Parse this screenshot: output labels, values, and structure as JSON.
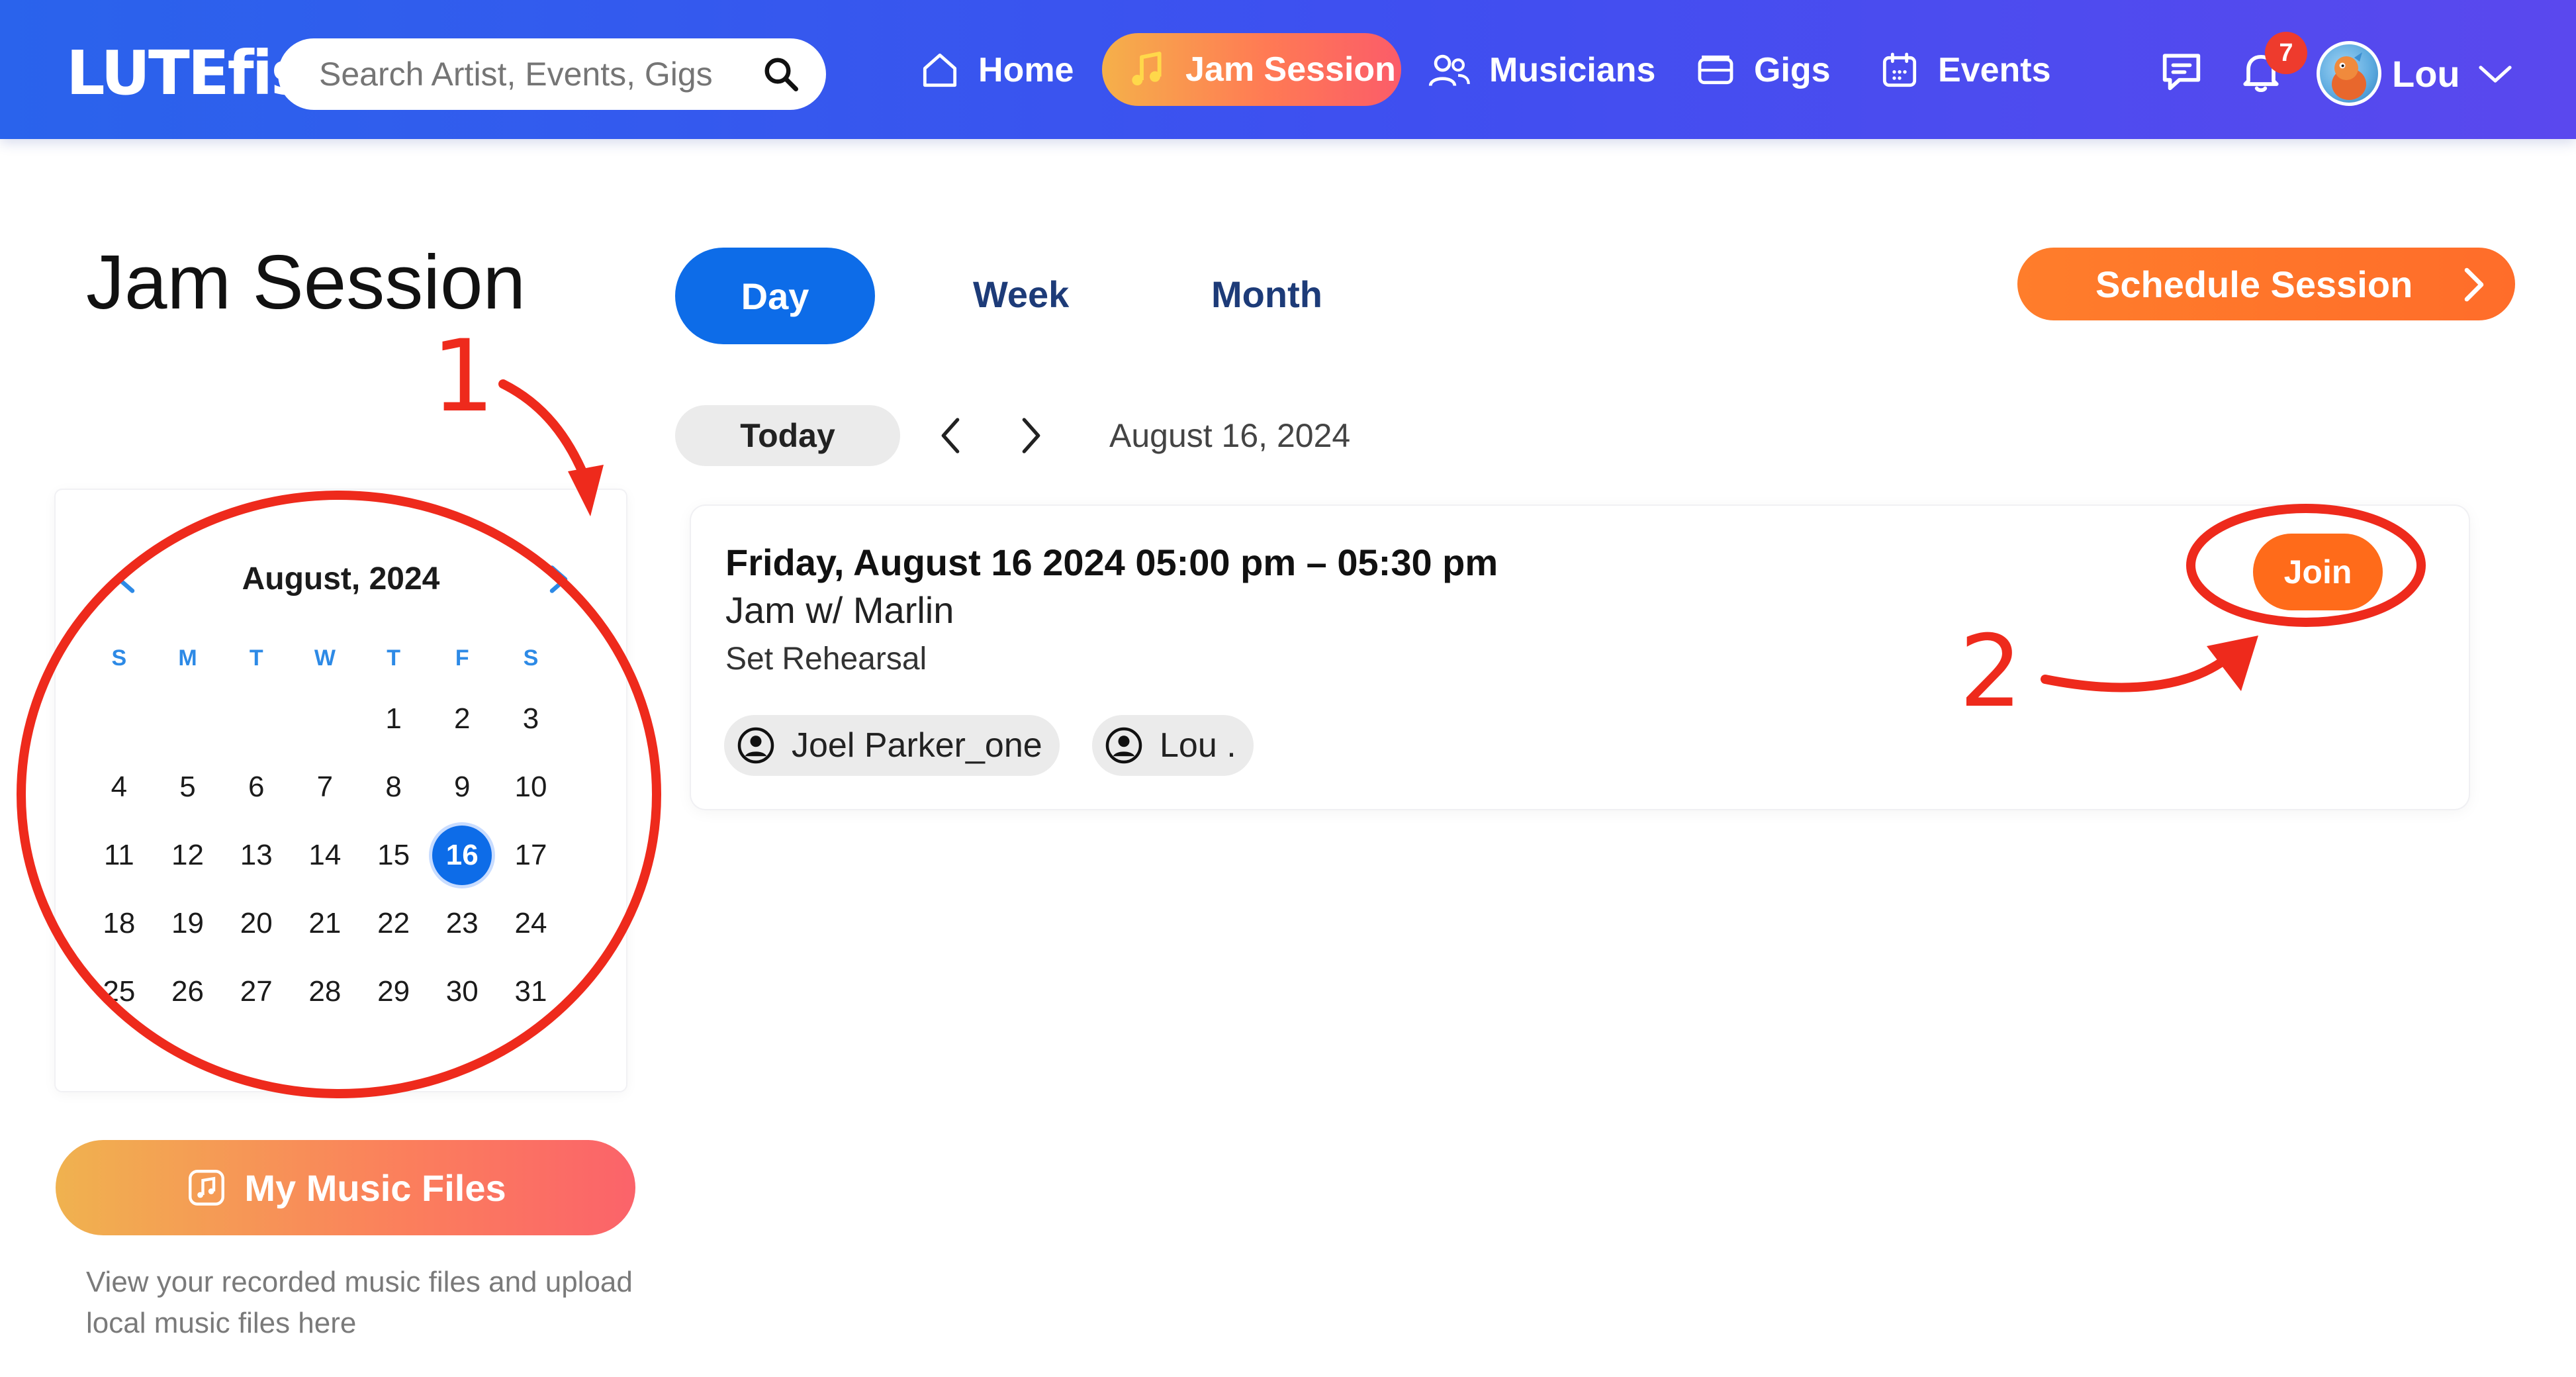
{
  "app": {
    "logo_text": "LUTEfish"
  },
  "search": {
    "placeholder": "Search Artist, Events, Gigs"
  },
  "nav": {
    "items": [
      {
        "label": "Home",
        "icon": "home-icon"
      },
      {
        "label": "Jam Session",
        "icon": "music-note-icon",
        "active": true
      },
      {
        "label": "Musicians",
        "icon": "users-icon"
      },
      {
        "label": "Gigs",
        "icon": "gigs-icon"
      },
      {
        "label": "Events",
        "icon": "calendar-icon"
      }
    ]
  },
  "header_right": {
    "notification_count": "7",
    "user_name": "Lou"
  },
  "page": {
    "title": "Jam Session"
  },
  "view_tabs": {
    "day": "Day",
    "week": "Week",
    "month": "Month",
    "active": "Day"
  },
  "schedule_button": {
    "label": "Schedule Session"
  },
  "date_nav": {
    "today_label": "Today",
    "current_date": "August 16, 2024"
  },
  "mini_calendar": {
    "title": "August, 2024",
    "weekdays": [
      "S",
      "M",
      "T",
      "W",
      "T",
      "F",
      "S"
    ],
    "weeks": [
      [
        "",
        "",
        "",
        "",
        "1",
        "2",
        "3"
      ],
      [
        "4",
        "5",
        "6",
        "7",
        "8",
        "9",
        "10"
      ],
      [
        "11",
        "12",
        "13",
        "14",
        "15",
        "16",
        "17"
      ],
      [
        "18",
        "19",
        "20",
        "21",
        "22",
        "23",
        "24"
      ],
      [
        "25",
        "26",
        "27",
        "28",
        "29",
        "30",
        "31"
      ]
    ],
    "selected_day": "16"
  },
  "music_files": {
    "button_label": "My Music Files",
    "description": "View your recorded music files and upload local music files here"
  },
  "event": {
    "datetime": "Friday, August 16 2024 05:00 pm – 05:30 pm",
    "title": "Jam w/ Marlin",
    "description": "Set Rehearsal",
    "participants": [
      "Joel Parker_one",
      "Lou ."
    ],
    "join_label": "Join"
  },
  "annotations": {
    "step_1": "1",
    "step_2": "2"
  },
  "colors": {
    "header_gradient_start": "#2a63ec",
    "header_gradient_end": "#5a48ee",
    "primary_blue": "#0d6ce8",
    "accent_orange": "#ff6b1a",
    "annotation_red": "#ee2a1c"
  }
}
